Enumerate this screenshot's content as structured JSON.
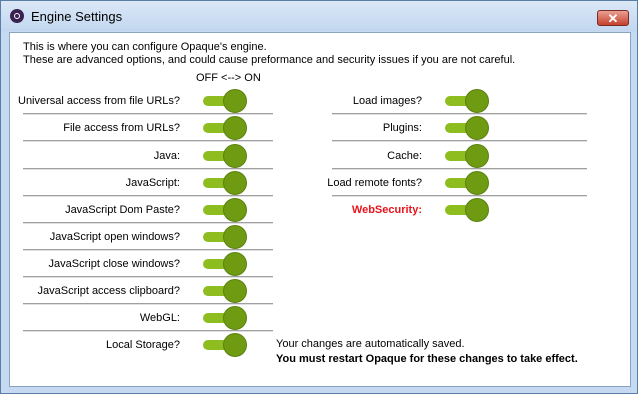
{
  "window": {
    "title": "Engine Settings",
    "close_glyph": "✕"
  },
  "intro": {
    "line1": "This is where you can configure Opaque's engine.",
    "line2": "These are advanced options, and could cause preformance and security issues if you are not careful.",
    "toggle_header": "OFF <--> ON"
  },
  "left_options": [
    {
      "label": "Universal access from file URLs?",
      "on": true
    },
    {
      "label": "File access from URLs?",
      "on": true
    },
    {
      "label": "Java:",
      "on": true
    },
    {
      "label": "JavaScript:",
      "on": true
    },
    {
      "label": "JavaScript Dom Paste?",
      "on": true
    },
    {
      "label": "JavaScript open windows?",
      "on": true
    },
    {
      "label": "JavaScript close windows?",
      "on": true
    },
    {
      "label": "JavaScript access clipboard?",
      "on": true
    },
    {
      "label": "WebGL:",
      "on": true
    },
    {
      "label": "Local Storage?",
      "on": true
    }
  ],
  "right_options": [
    {
      "label": "Load images?",
      "on": true
    },
    {
      "label": "Plugins:",
      "on": true
    },
    {
      "label": "Cache:",
      "on": true
    },
    {
      "label": "Load remote fonts?",
      "on": true
    },
    {
      "label": "WebSecurity:",
      "on": true
    }
  ],
  "footer": {
    "saved": "Your changes are automatically saved.",
    "restart": "You must restart Opaque for these changes to take effect."
  },
  "colors": {
    "toggle_on": "#8dbd1f",
    "knob": "#6f9b12",
    "warning": "#e8141b"
  }
}
